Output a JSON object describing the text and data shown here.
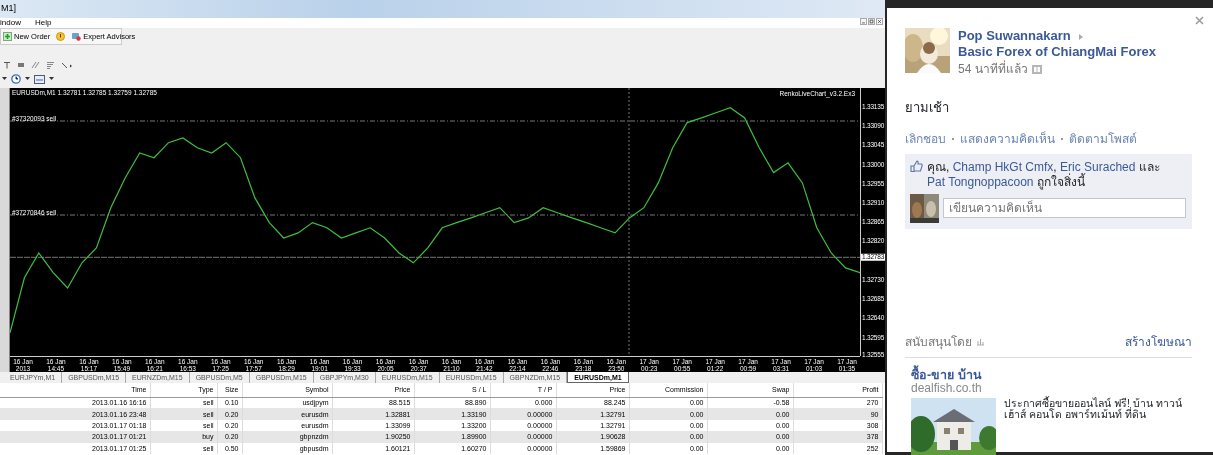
{
  "window": {
    "title": "M1]"
  },
  "menu": [
    {
      "label": "indow"
    },
    {
      "label": "Help"
    }
  ],
  "toolbar": {
    "buttons": [
      {
        "label": "New Order"
      },
      {
        "label": "Expert Advisors"
      }
    ]
  },
  "chart": {
    "header": "EURUSDm,M1  1.32781 1.32785 1.32759 1.32785",
    "indicator": "RenkoLiveChart_v3.2.Ex3",
    "order_lines": [
      {
        "label": "#37320093 sell"
      },
      {
        "label": "#37270846 sell"
      }
    ],
    "current_price": "1.32783",
    "time_labels": [
      "16 Jan 2013",
      "16 Jan 14:45",
      "16 Jan 15:17",
      "16 Jan 15:49",
      "16 Jan 16:21",
      "16 Jan 16:53",
      "16 Jan 17:25",
      "16 Jan 17:57",
      "16 Jan 18:29",
      "16 Jan 19:01",
      "16 Jan 19:33",
      "16 Jan 20:05",
      "16 Jan 20:37",
      "16 Jan 21:10",
      "16 Jan 21:42",
      "16 Jan 22:14",
      "16 Jan 22:46",
      "16 Jan 23:18",
      "16 Jan 23:50",
      "17 Jan 00:23",
      "17 Jan 00:55",
      "17 Jan 01:22",
      "17 Jan 00:59",
      "17 Jan 03:31",
      "17 Jan 01:03",
      "17 Jan 01:35"
    ],
    "chart_data": {
      "type": "line",
      "ylim": [
        1.32552,
        1.33179
      ],
      "yticks": [
        {
          "value": 1.33135,
          "label": "1.33135"
        },
        {
          "value": 1.3309,
          "label": "1.33090"
        },
        {
          "value": 1.33045,
          "label": "1.33045"
        },
        {
          "value": 1.33,
          "label": "1.33000"
        },
        {
          "value": 1.32955,
          "label": "1.32955"
        },
        {
          "value": 1.3291,
          "label": "1.32910"
        },
        {
          "value": 1.32865,
          "label": "1.32865"
        },
        {
          "value": 1.3282,
          "label": "1.32820"
        },
        {
          "value": 1.3273,
          "label": "1.32730"
        },
        {
          "value": 1.32685,
          "label": "1.32685"
        },
        {
          "value": 1.3264,
          "label": "1.32640"
        },
        {
          "value": 1.32595,
          "label": "1.32595"
        },
        {
          "value": 1.32555,
          "label": "1.32555"
        }
      ],
      "series": [
        {
          "color": "#3fbf3f",
          "values": [
            1.32606,
            1.32735,
            1.32793,
            1.32747,
            1.32711,
            1.3277,
            1.32805,
            1.32899,
            1.32969,
            1.33027,
            1.33016,
            1.33051,
            1.33062,
            1.33039,
            1.33027,
            1.33051,
            1.33016,
            1.32922,
            1.32864,
            1.32828,
            1.3284,
            1.32864,
            1.32852,
            1.32828,
            1.3284,
            1.32852,
            1.32828,
            1.32793,
            1.3277,
            1.32805,
            1.32852,
            1.32864,
            1.32875,
            1.32887,
            1.32899,
            1.32864,
            1.32875,
            1.32899,
            1.32887,
            1.32875,
            1.32864,
            1.32852,
            1.3284,
            1.32875,
            1.32899,
            1.32957,
            1.33039,
            1.33098,
            1.33109,
            1.33121,
            1.33133,
            1.33109,
            1.33039,
            1.32981,
            1.33004,
            1.32957,
            1.32852,
            1.32793,
            1.32758,
            1.32747
          ]
        }
      ]
    }
  },
  "chart_tabs": [
    {
      "label": "EURJPYm,M1",
      "selected": false
    },
    {
      "label": "GBPUSDm,M15",
      "selected": false
    },
    {
      "label": "EURNZDm,M15",
      "selected": false
    },
    {
      "label": "GBPUSDm,M5",
      "selected": false
    },
    {
      "label": "GBPUSDm,M15",
      "selected": false
    },
    {
      "label": "GBPJPYm,M30",
      "selected": false
    },
    {
      "label": "EURUSDm,M15",
      "selected": false
    },
    {
      "label": "EURUSDm,M15",
      "selected": false
    },
    {
      "label": "GBPNZDm,M15",
      "selected": false
    },
    {
      "label": "EURUSDm,M1",
      "selected": true
    }
  ],
  "trades": {
    "columns": [
      "Time",
      "Type",
      "Size",
      "Symbol",
      "Price",
      "S / L",
      "T / P",
      "Price",
      "Commission",
      "Swap",
      "Profit"
    ],
    "rows": [
      [
        "2013.01.16 16:16",
        "sell",
        "0.10",
        "usdjpym",
        "88.515",
        "88.890",
        "0.000",
        "88.245",
        "0.00",
        "-0.58",
        "270"
      ],
      [
        "2013.01.16 23:48",
        "sell",
        "0.20",
        "eurusdm",
        "1.32881",
        "1.33190",
        "0.00000",
        "1.32791",
        "0.00",
        "0.00",
        "90"
      ],
      [
        "2013.01.17 01:18",
        "sell",
        "0.20",
        "eurusdm",
        "1.33099",
        "1.33200",
        "0.00000",
        "1.32791",
        "0.00",
        "0.00",
        "308"
      ],
      [
        "2013.01.17 01:21",
        "buy",
        "0.20",
        "gbpnzdm",
        "1.90250",
        "1.89900",
        "0.00000",
        "1.90628",
        "0.00",
        "0.00",
        "378"
      ],
      [
        "2013.01.17 01:25",
        "sell",
        "0.50",
        "gbpusdm",
        "1.60121",
        "1.60270",
        "0.00000",
        "1.59869",
        "0.00",
        "0.00",
        "252"
      ]
    ]
  },
  "post": {
    "author": "Pop Suwannakarn",
    "target": "Basic Forex of ChiangMai Forex",
    "time": "54 นาทีที่แล้ว",
    "text": "ยามเช้า",
    "actions": [
      {
        "label": "เลิกชอบ"
      },
      {
        "label": "แสดงความคิดเห็น"
      },
      {
        "label": "ติดตามโพสต์"
      }
    ],
    "likes": [
      {
        "kind": "plain",
        "text": "คุณ, "
      },
      {
        "kind": "link",
        "text": "Champ HkGt Cmfx"
      },
      {
        "kind": "plain",
        "text": ", "
      },
      {
        "kind": "link",
        "text": "Eric Surached"
      },
      {
        "kind": "plain",
        "text": " และ "
      },
      {
        "kind": "link",
        "text": "Pat Tongnoppacoon"
      },
      {
        "kind": "plain",
        "text": " ถูกใจสิ่งนี้"
      }
    ],
    "comment": {
      "placeholder": "เขียนความคิดเห็น"
    }
  },
  "sponsored": {
    "label": "สนับสนุนโดย",
    "create_ad": "สร้างโฆษณา"
  },
  "ad": {
    "title": "ซื้อ-ขาย บ้าน",
    "domain": "dealfish.co.th",
    "text": "ประกาศซื้อขายออนไลน์ ฟรี! บ้าน ทาวน์เฮ้าส์ คอนโด อพาร์ทเม้นท์ ที่ดิน"
  }
}
